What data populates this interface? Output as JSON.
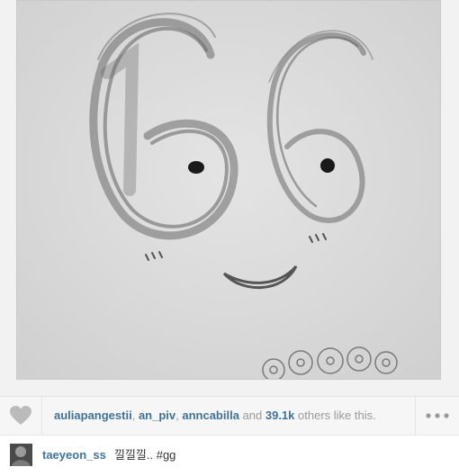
{
  "post": {
    "likers": [
      "auliapangestii",
      "an_piv",
      "anncabilla"
    ],
    "separator_1": ", ",
    "separator_2": ", ",
    "and_word": " and ",
    "like_count": "39.1k",
    "others_text": " others like this."
  },
  "comment": {
    "username": "taeyeon_ss",
    "text": "낄낄낄.. #gg"
  },
  "icons": {
    "like": "heart-icon",
    "more": "more-options-icon"
  },
  "colors": {
    "link": "#3f729b",
    "muted": "#999999",
    "icon": "#bbbbbb"
  }
}
